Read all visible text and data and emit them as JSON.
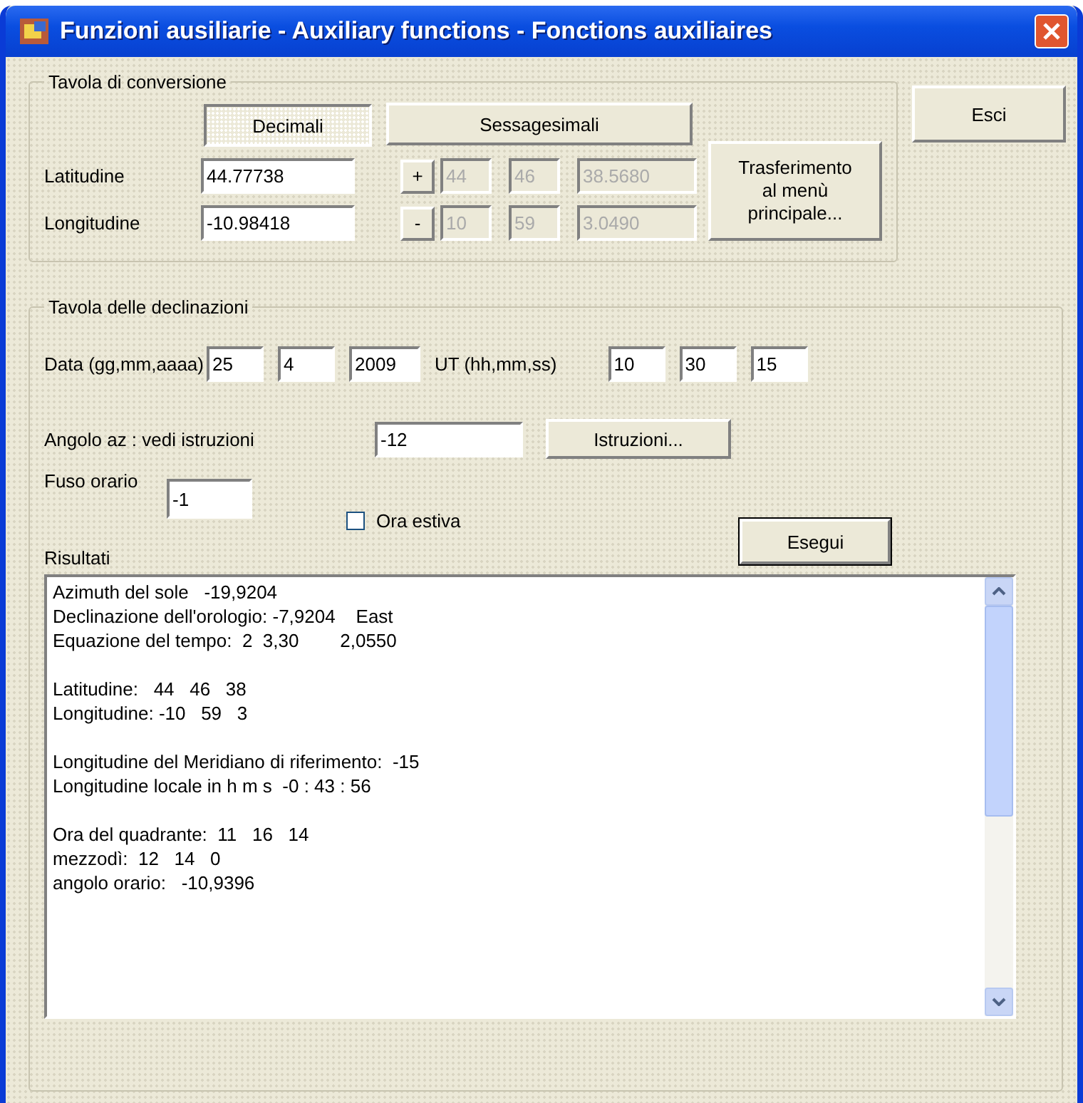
{
  "window": {
    "title": "Funzioni ausiliarie - Auxiliary functions - Fonctions auxiliaires"
  },
  "conversion": {
    "title": "Tavola di conversione",
    "modes": [
      {
        "label": "Decimali",
        "selected": true
      },
      {
        "label": "Sessagesimali",
        "selected": false
      }
    ],
    "rows": [
      {
        "label": "Latitudine",
        "decimal": "44.77738",
        "sign": "+",
        "sexagesimal": [
          {
            "value": "44",
            "disabled": true
          },
          {
            "value": "46",
            "disabled": true
          },
          {
            "value": "38.5680",
            "disabled": true
          }
        ]
      },
      {
        "label": "Longitudine",
        "decimal": "-10.98418",
        "sign": "-",
        "sexagesimal": [
          {
            "value": "10",
            "disabled": true
          },
          {
            "value": "59",
            "disabled": true
          },
          {
            "value": "3.0490",
            "disabled": true
          }
        ]
      }
    ],
    "transfer_button": "Trasferimento\nal menù\nprincipale..."
  },
  "exit_button": "Esci",
  "declinations": {
    "title": "Tavola delle declinazioni",
    "date_label": "Data (gg,mm,aaaa)",
    "date": [
      "25",
      "4",
      "2009"
    ],
    "time_label": "UT (hh,mm,ss)",
    "time": [
      "10",
      "30",
      "15"
    ],
    "angle_label": "Angolo az : vedi istruzioni",
    "angle": "-12",
    "instructions_button": "Istruzioni...",
    "timezone_label": "Fuso orario",
    "timezone": "-1",
    "summer_time": {
      "label": "Ora estiva",
      "checked": false
    },
    "run_button": "Esegui",
    "results_label": "Risultati",
    "results": [
      [
        "Azimuth del sole   -19,9204",
        "Declinazione dell'orologio: -7,9204    East",
        "Equazione del tempo:  2  3,30        2,0550"
      ],
      [
        "Latitudine:   44   46   38",
        "Longitudine: -10   59   3"
      ],
      [
        "Longitudine del Meridiano di riferimento:  -15",
        "Longitudine locale in h m s  -0 : 43 : 56"
      ],
      [
        "Ora del quadrante:  11   16   14",
        "mezzodì:  12   14   0",
        "angolo orario:   -10,9396"
      ]
    ]
  }
}
